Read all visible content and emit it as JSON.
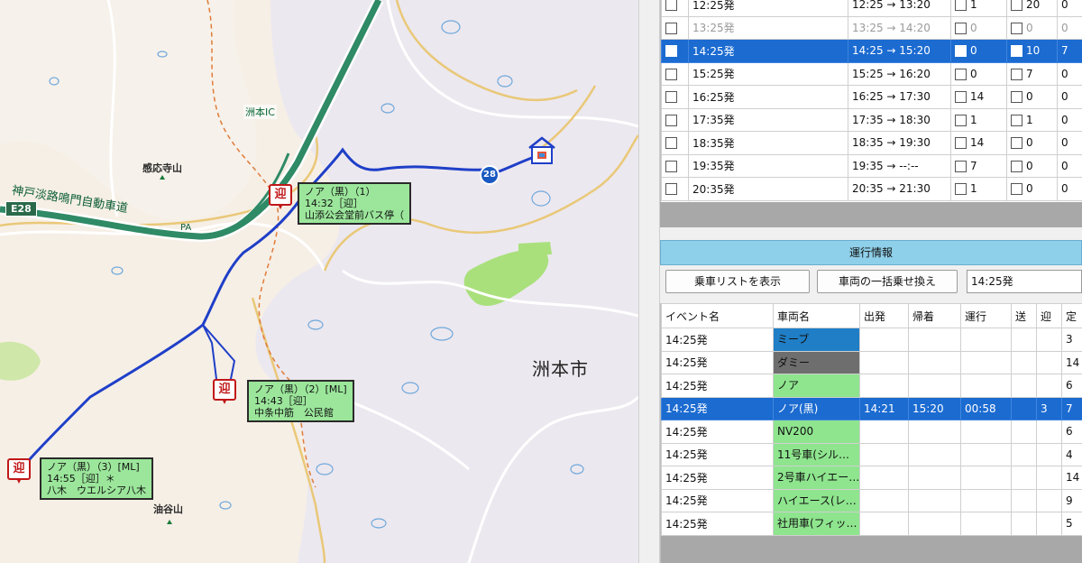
{
  "map": {
    "city_label": "洲本市",
    "ic_label": "洲本IC",
    "highway_label": "神戸淡路鳴門自動車道",
    "highway_pa": "PA",
    "e28_shield": "E28",
    "route_28_badge": "28",
    "peaks": [
      {
        "name": "感応寺山"
      },
      {
        "name": "油谷山"
      }
    ],
    "pickup_marker_label": "迎",
    "stops": [
      {
        "line1": "ノア（黒）（1）",
        "line2": "14:32［迎］",
        "line3": "山添公会堂前バス停（"
      },
      {
        "line1": "ノア（黒）（2）[ML]",
        "line2": "14:43［迎］",
        "line3": "中条中筋　公民館"
      },
      {
        "line1": "ノア（黒）（3）[ML]",
        "line2": "14:55［迎］＊",
        "line3": "八木　ウエルシア八木"
      }
    ],
    "colors": {
      "route": "#1f3fc8",
      "highway": "#2f8a66",
      "stop_card": "#9be69b",
      "pickup": "#c01818"
    }
  },
  "schedule": {
    "rows": [
      {
        "label": "12:25発",
        "range": "12:25 → 13:20",
        "send": "1",
        "send_checked": false,
        "pick": "20",
        "pick_checked": false,
        "last": "0",
        "selected": false,
        "dim": false
      },
      {
        "label": "13:25発",
        "range": "13:25 → 14:20",
        "send": "0",
        "send_checked": false,
        "pick": "0",
        "pick_checked": false,
        "last": "0",
        "selected": false,
        "dim": true
      },
      {
        "label": "14:25発",
        "range": "14:25 → 15:20",
        "send": "0",
        "send_checked": true,
        "pick": "10",
        "pick_checked": true,
        "last": "7",
        "selected": true,
        "dim": false
      },
      {
        "label": "15:25発",
        "range": "15:25 → 16:20",
        "send": "0",
        "send_checked": false,
        "pick": "7",
        "pick_checked": false,
        "last": "0",
        "selected": false,
        "dim": false
      },
      {
        "label": "16:25発",
        "range": "16:25 → 17:30",
        "send": "14",
        "send_checked": false,
        "pick": "0",
        "pick_checked": false,
        "last": "0",
        "selected": false,
        "dim": false
      },
      {
        "label": "17:35発",
        "range": "17:35 → 18:30",
        "send": "1",
        "send_checked": false,
        "pick": "1",
        "pick_checked": false,
        "last": "0",
        "selected": false,
        "dim": false
      },
      {
        "label": "18:35発",
        "range": "18:35 → 19:30",
        "send": "14",
        "send_checked": false,
        "pick": "0",
        "pick_checked": false,
        "last": "0",
        "selected": false,
        "dim": false
      },
      {
        "label": "19:35発",
        "range": "19:35 → --:--",
        "send": "7",
        "send_checked": false,
        "pick": "0",
        "pick_checked": false,
        "last": "0",
        "selected": false,
        "dim": false
      },
      {
        "label": "20:35発",
        "range": "20:35 → 21:30",
        "send": "1",
        "send_checked": false,
        "pick": "0",
        "pick_checked": false,
        "last": "0",
        "selected": false,
        "dim": false
      }
    ]
  },
  "run_info": {
    "header": "運行情報",
    "show_list_button": "乗車リストを表示",
    "bulk_transfer_button": "車両の一括乗せ換え",
    "time_field_value": "14:25発",
    "columns": [
      "イベント名",
      "車両名",
      "出発",
      "帰着",
      "運行",
      "送",
      "迎",
      "定"
    ],
    "rows": [
      {
        "event": "14:25発",
        "vehicle": "ミーブ",
        "color": "#1f7ec6",
        "dep": "",
        "ret": "",
        "dur": "",
        "send": "",
        "pick": "",
        "cap": "3",
        "selected": false
      },
      {
        "event": "14:25発",
        "vehicle": "ダミー",
        "color": "#6e6e6e",
        "dep": "",
        "ret": "",
        "dur": "",
        "send": "",
        "pick": "",
        "cap": "14",
        "selected": false
      },
      {
        "event": "14:25発",
        "vehicle": "ノア",
        "color": "#8ee58e",
        "dep": "",
        "ret": "",
        "dur": "",
        "send": "",
        "pick": "",
        "cap": "6",
        "selected": false
      },
      {
        "event": "14:25発",
        "vehicle": "ノア(黒)",
        "color": "#8ee58e",
        "dep": "14:21",
        "ret": "15:20",
        "dur": "00:58",
        "send": "",
        "pick": "3",
        "cap": "7",
        "selected": true
      },
      {
        "event": "14:25発",
        "vehicle": "NV200",
        "color": "#8ee58e",
        "dep": "",
        "ret": "",
        "dur": "",
        "send": "",
        "pick": "",
        "cap": "6",
        "selected": false
      },
      {
        "event": "14:25発",
        "vehicle": "11号車(シル…",
        "color": "#8ee58e",
        "dep": "",
        "ret": "",
        "dur": "",
        "send": "",
        "pick": "",
        "cap": "4",
        "selected": false
      },
      {
        "event": "14:25発",
        "vehicle": "2号車ハイエー…",
        "color": "#8ee58e",
        "dep": "",
        "ret": "",
        "dur": "",
        "send": "",
        "pick": "",
        "cap": "14",
        "selected": false
      },
      {
        "event": "14:25発",
        "vehicle": "ハイエース(レ…",
        "color": "#8ee58e",
        "dep": "",
        "ret": "",
        "dur": "",
        "send": "",
        "pick": "",
        "cap": "9",
        "selected": false
      },
      {
        "event": "14:25発",
        "vehicle": "社用車(フィッ…",
        "color": "#8ee58e",
        "dep": "",
        "ret": "",
        "dur": "",
        "send": "",
        "pick": "",
        "cap": "5",
        "selected": false
      }
    ]
  }
}
